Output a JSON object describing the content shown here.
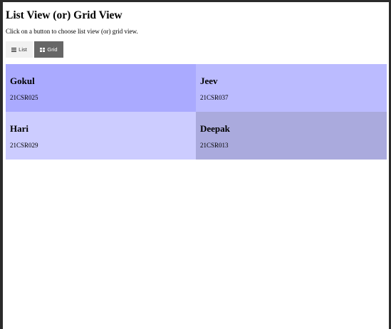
{
  "page": {
    "title": "List View (or) Grid View",
    "instruction": "Click on a button to choose list view (or) grid view."
  },
  "toolbar": {
    "list_label": "List",
    "list_icon": "list-icon",
    "grid_label": "Grid",
    "grid_icon": "grid-icon",
    "active_view": "grid"
  },
  "students": [
    {
      "name": "Gokul",
      "reg": "21CSR025",
      "color": "#aaaaff"
    },
    {
      "name": "Jeev",
      "reg": "21CSR037",
      "color": "#bbbbff"
    },
    {
      "name": "Hari",
      "reg": "21CSR029",
      "color": "#ccccff"
    },
    {
      "name": "Deepak",
      "reg": "21CSR013",
      "color": "#aaaadd"
    }
  ]
}
